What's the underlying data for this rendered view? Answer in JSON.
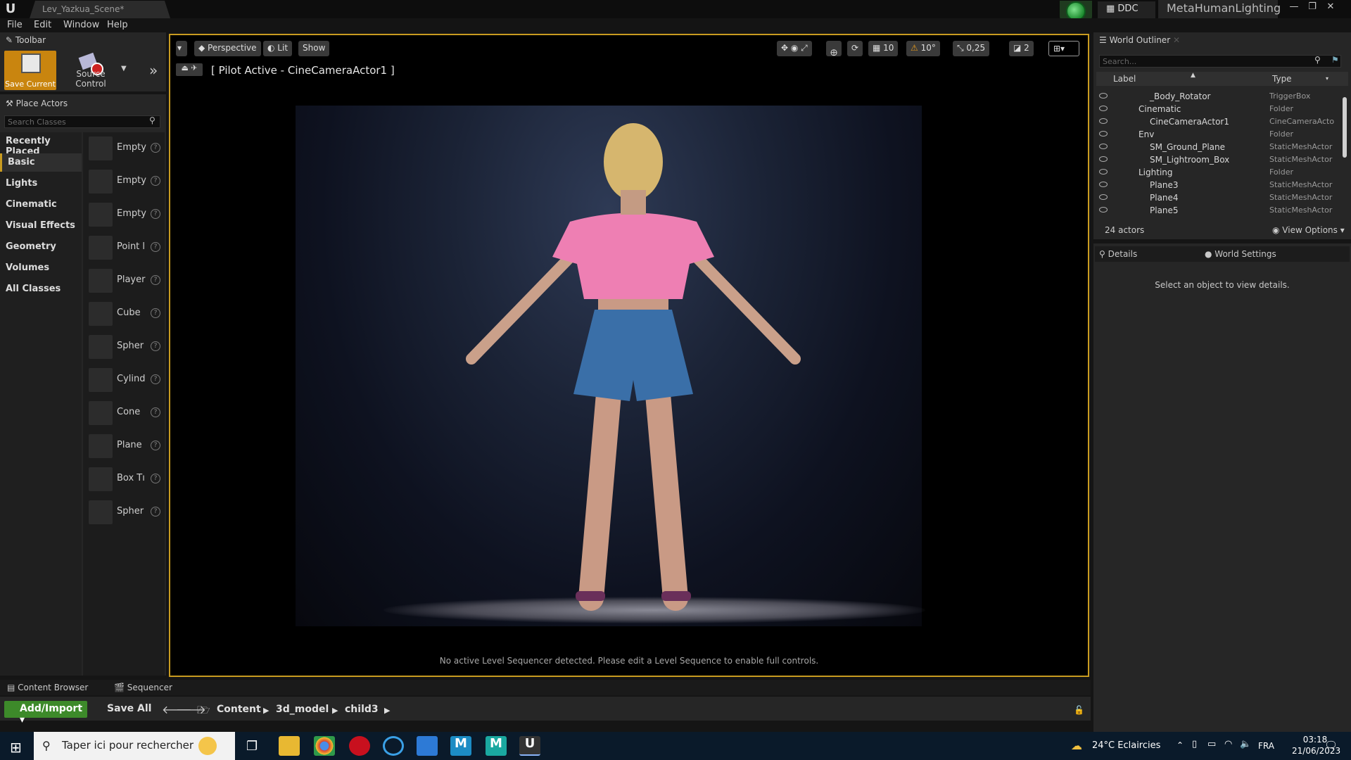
{
  "window": {
    "level_tab": "Lev_Yazkua_Scene*",
    "ddc": "DDC",
    "project": "MetaHumanLighting"
  },
  "menu": [
    "File",
    "Edit",
    "Window",
    "Help"
  ],
  "toolbar": {
    "tab": "Toolbar",
    "save_current": "Save Current",
    "source_control": "Source Control"
  },
  "place_actors": {
    "tab": "Place Actors",
    "search_placeholder": "Search Classes",
    "categories": [
      "Recently Placed",
      "Basic",
      "Lights",
      "Cinematic",
      "Visual Effects",
      "Geometry",
      "Volumes",
      "All Classes"
    ],
    "selected_category": "Basic",
    "actors": [
      "Empty",
      "Empty",
      "Empty",
      "Point l",
      "Player",
      "Cube",
      "Spher",
      "Cylind",
      "Cone",
      "Plane",
      "Box Tı",
      "Spher"
    ]
  },
  "viewport": {
    "perspective": "Perspective",
    "lit": "Lit",
    "show": "Show",
    "grid_snap": "10",
    "rot_snap": "10°",
    "scale_snap": "0,25",
    "cam_speed": "2",
    "pilot": "[ Pilot Active - CineCameraActor1 ]",
    "sequencer_msg": "No active Level Sequencer detected. Please edit a Level Sequence to enable full controls."
  },
  "world_outliner": {
    "tab": "World Outliner",
    "search_placeholder": "Search...",
    "col_label": "Label",
    "col_type": "Type",
    "rows": [
      {
        "label": "_Body_Rotator",
        "type": "TriggerBox",
        "indent": 3
      },
      {
        "label": "Cinematic",
        "type": "Folder",
        "indent": 2
      },
      {
        "label": "CineCameraActor1",
        "type": "CineCameraActo",
        "indent": 3
      },
      {
        "label": "Env",
        "type": "Folder",
        "indent": 2
      },
      {
        "label": "SM_Ground_Plane",
        "type": "StaticMeshActor",
        "indent": 3
      },
      {
        "label": "SM_Lightroom_Box",
        "type": "StaticMeshActor",
        "indent": 3
      },
      {
        "label": "Lighting",
        "type": "Folder",
        "indent": 2
      },
      {
        "label": "Plane3",
        "type": "StaticMeshActor",
        "indent": 3
      },
      {
        "label": "Plane4",
        "type": "StaticMeshActor",
        "indent": 3
      },
      {
        "label": "Plane5",
        "type": "StaticMeshActor",
        "indent": 3
      }
    ],
    "actor_count": "24 actors",
    "view_options": "View Options"
  },
  "details": {
    "tab": "Details",
    "world_settings": "World Settings",
    "message": "Select an object to view details."
  },
  "content_browser": {
    "tab": "Content Browser",
    "sequencer_tab": "Sequencer",
    "add_import": "Add/Import",
    "save_all": "Save All",
    "path": [
      "Content",
      "3d_model",
      "child3"
    ]
  },
  "taskbar": {
    "search": "Taper ici pour rechercher",
    "weather": "24°C Eclaircies",
    "lang": "FRA",
    "time": "03:18",
    "date": "21/06/2023"
  },
  "colors": {
    "accent": "#c89b20",
    "save_button": "#c9850f",
    "add_import": "#3d8a2a"
  }
}
